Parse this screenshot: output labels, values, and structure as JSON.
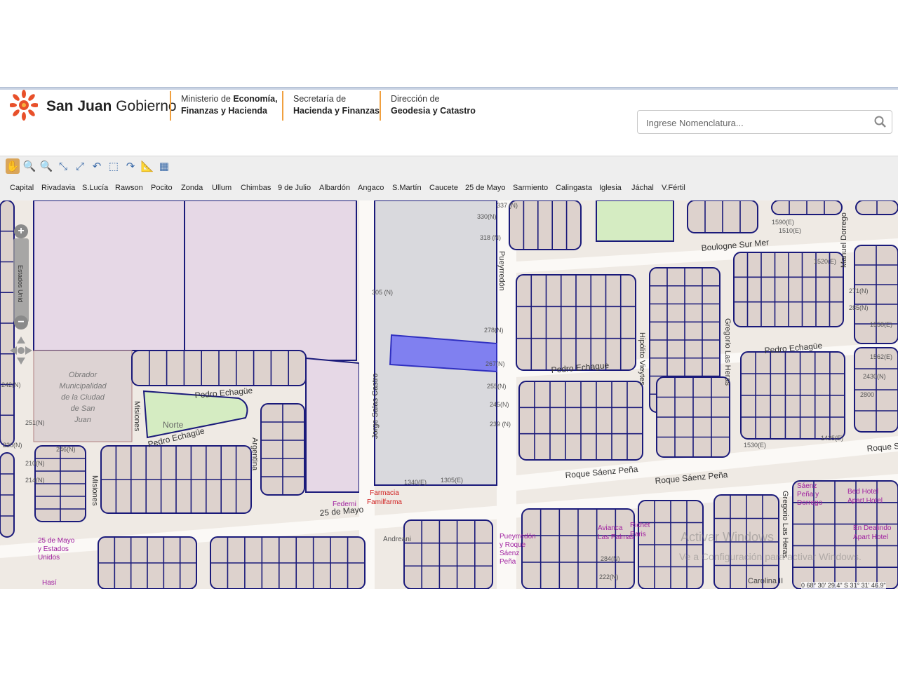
{
  "header": {
    "brand_bold": "San Juan",
    "brand_light": " Gobierno",
    "org1_line1_pre": "Ministerio de ",
    "org1_line1_bold": "Economía,",
    "org1_line2": "Finanzas y Hacienda",
    "org2_line1": "Secretaría  de",
    "org2_line2": "Hacienda y Finanzas",
    "org3_line1": "Dirección de",
    "org3_line2": "Geodesia y Catastro"
  },
  "search": {
    "placeholder": "Ingrese Nomenclatura..."
  },
  "colors": {
    "accent": "#f0a040",
    "parcel": "#1a1a7a",
    "selected": "#8080f0",
    "logo": "#e8502a"
  },
  "toolbar": {
    "tools": [
      "pan-hand-icon",
      "zoom-in-icon",
      "zoom-out-icon",
      "zoom-extent-icon",
      "full-extent-icon",
      "undo-icon",
      "select-box-icon",
      "redo-icon",
      "measure-icon",
      "grid-icon"
    ]
  },
  "departments": [
    "Capital",
    "Rivadavia",
    "S.Lucía",
    "Rawson",
    "Pocito",
    "Zonda",
    "Ullum",
    "Chimbas",
    "9 de Julio",
    "Albardón",
    "Angaco",
    "S.Martín",
    "Caucete",
    "25 de Mayo",
    "Sarmiento",
    "Calingasta",
    "Iglesia",
    "Jáchal",
    "V.Fértil"
  ],
  "map": {
    "zoom_label": "Estados Unid",
    "coords": "0  68° 30' 29.4\"  S 31° 31' 46.9\"",
    "watermark": "Activar Windows",
    "watermark_sub": "Ve a Configuración para activar Windows.",
    "streets": {
      "pedro_echague_1": "Pedro Echagüe",
      "pedro_echague_2": "Pedro Echagüe",
      "pedro_echague_3": "Pedro Echague",
      "pedro_echague_4": "Pedro Echagüe",
      "misiones_1": "Misiones",
      "misiones_2": "Misiones",
      "argentina": "Argentina",
      "jorge_salas_castro": "Jorge Salas Castro",
      "pueyrredon": "Pueyrredón",
      "hipolito_vieytes": "Hipólito Vieytes",
      "gregorio_las_heras_1": "Gregorio Las Heras",
      "gregorio_las_heras_2": "Gregorio Las Heras",
      "boulogne_sur_mer": "Boulogne Sur Mer",
      "manuel_dorrego": "Manuel Dorrego",
      "roque_saenz_pena_1": "Roque Sáenz Peña",
      "roque_saenz_pena_2": "Roque Sáenz Peña",
      "roque_saenz_pena_3": "Roque Sae",
      "veinticinco_de_mayo": "25 de Mayo",
      "norte": "Norte"
    },
    "places": {
      "obrador": [
        "Obrador",
        "Municipalidad",
        "de la Ciudad",
        "de San",
        "Juan"
      ],
      "farmacia": [
        "Farmacia",
        "Familfarma"
      ],
      "federni": "Federni",
      "andreani": "Andreani",
      "aviacion": [
        "Avianca",
        "Las Palmas"
      ],
      "riche": [
        "Richet",
        "Paris"
      ],
      "en_dealindo": [
        "En Dealindo",
        "Apart Hotel"
      ],
      "carolina": "Carolina II",
      "estados_unidos": [
        "25 de Mayo",
        "y Estados",
        "Unidos"
      ],
      "pueyrredon_saenz": [
        "Pueyrredón",
        "y Roque",
        "Sáenz",
        "Peña"
      ],
      "saenz_dorrego": [
        "Sáenz",
        "Peña y",
        "Dorrego"
      ],
      "apart_hotel": [
        "Bed Hotel",
        "Apart Hotel"
      ],
      "hasi": "Hasí"
    },
    "parcel_labels": [
      "337 (N)",
      "330(N)",
      "318 (N)",
      "305 (N)",
      "278(N)",
      "267(N)",
      "255(N)",
      "245(N)",
      "239 (N)",
      "242(N)",
      "251(N)",
      "220(N)",
      "246(N)",
      "210(N)",
      "214(N)",
      "1340(E)",
      "1305(E)",
      "284(N)",
      "222(N)",
      "1590(E)",
      "1510(E)",
      "1520(E)",
      "1558(E)",
      "1562(E)",
      "2800",
      "271(N)",
      "285(N)",
      "2430(N)",
      "1530(E)",
      "1435(E)"
    ]
  }
}
